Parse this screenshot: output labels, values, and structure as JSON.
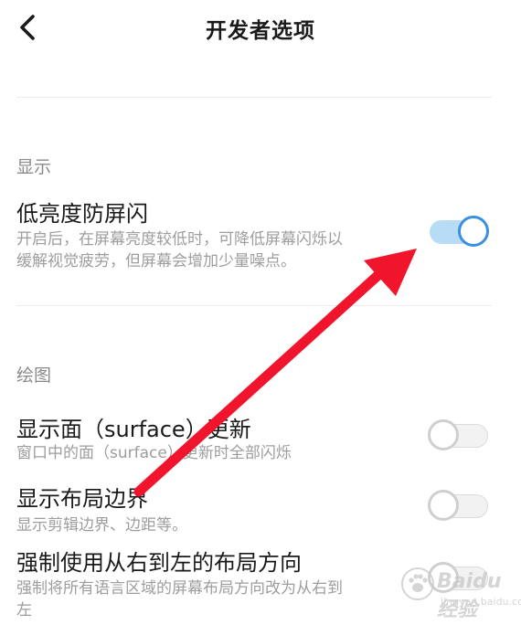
{
  "header": {
    "title": "开发者选项",
    "back_icon": "chevron-left-icon"
  },
  "sections": [
    {
      "title": "显示",
      "items": [
        {
          "title": "低亮度防屏闪",
          "subtitle_lines": [
            "开启后，在屏幕亮度较低时，可降低屏幕闪烁以",
            "缓解视觉疲劳，但屏幕会增加少量噪点。"
          ],
          "enabled": true
        }
      ]
    },
    {
      "title": "绘图",
      "items": [
        {
          "title": "显示面（surface）更新",
          "subtitle_lines": [
            "窗口中的面（surface）更新时全部闪烁"
          ],
          "enabled": false
        },
        {
          "title": "显示布局边界",
          "subtitle_lines": [
            "显示剪辑边界、边距等。"
          ],
          "enabled": false
        },
        {
          "title": "强制使用从右到左的布局方向",
          "subtitle_lines": [
            "强制将所有语言区域的屏幕布局方向改为从右到",
            "左"
          ],
          "enabled": false
        }
      ]
    }
  ],
  "colors": {
    "toggle_on_track": "#b8dcf6",
    "toggle_on_knob": "#3a8fe0",
    "toggle_off": "#cfcfcf",
    "annotation_arrow": "#f0142d"
  },
  "watermark": {
    "text": "Baidu经验",
    "url": "jingyan.baidu.com"
  }
}
